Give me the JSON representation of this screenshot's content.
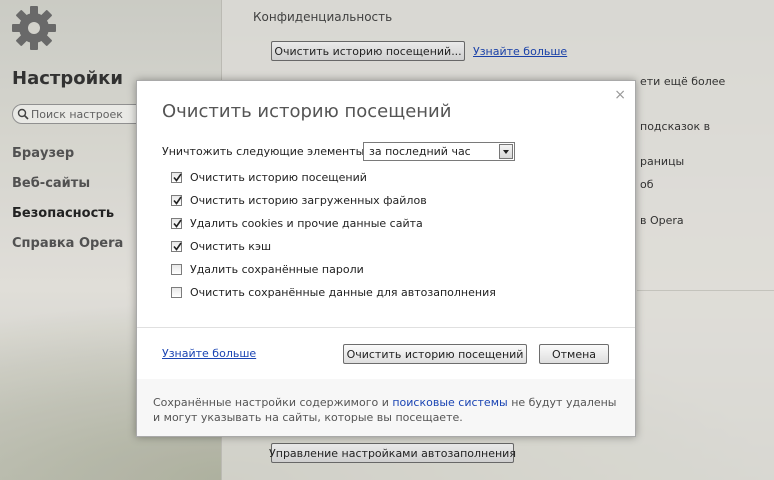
{
  "sidebar": {
    "title": "Настройки",
    "search_placeholder": "Поиск настроек",
    "items": [
      {
        "label": "Браузер"
      },
      {
        "label": "Веб-сайты"
      },
      {
        "label": "Безопасность"
      },
      {
        "label": "Справка Opera"
      }
    ]
  },
  "main": {
    "section_title": "Конфиденциальность",
    "clear_history_button": "Очистить историю посещений...",
    "learn_more": "Узнайте больше",
    "partial_texts": [
      "ети ещё более",
      "подсказок в",
      "раницы",
      "об",
      "в Opera"
    ],
    "autofill_button": "Управление настройками автозаполнения"
  },
  "dialog": {
    "title": "Очистить историю посещений",
    "close_symbol": "×",
    "destroy_label": "Уничтожить следующие элементы:",
    "period_value": "за последний час",
    "options": [
      {
        "label": "Очистить историю посещений",
        "checked": true
      },
      {
        "label": "Очистить историю загруженных файлов",
        "checked": true
      },
      {
        "label": "Удалить cookies и прочие данные сайта",
        "checked": true
      },
      {
        "label": "Очистить кэш",
        "checked": true
      },
      {
        "label": "Удалить сохранённые пароли",
        "checked": false
      },
      {
        "label": "Очистить сохранённые данные для автозаполнения",
        "checked": false
      }
    ],
    "learn_more": "Узнайте больше",
    "confirm_button": "Очистить историю посещений",
    "cancel_button": "Отмена",
    "footer_prefix": "Сохранённые настройки содержимого и",
    "footer_link": "поисковые системы",
    "footer_suffix": "не будут удалены и могут указывать на сайты, которые вы посещаете."
  }
}
